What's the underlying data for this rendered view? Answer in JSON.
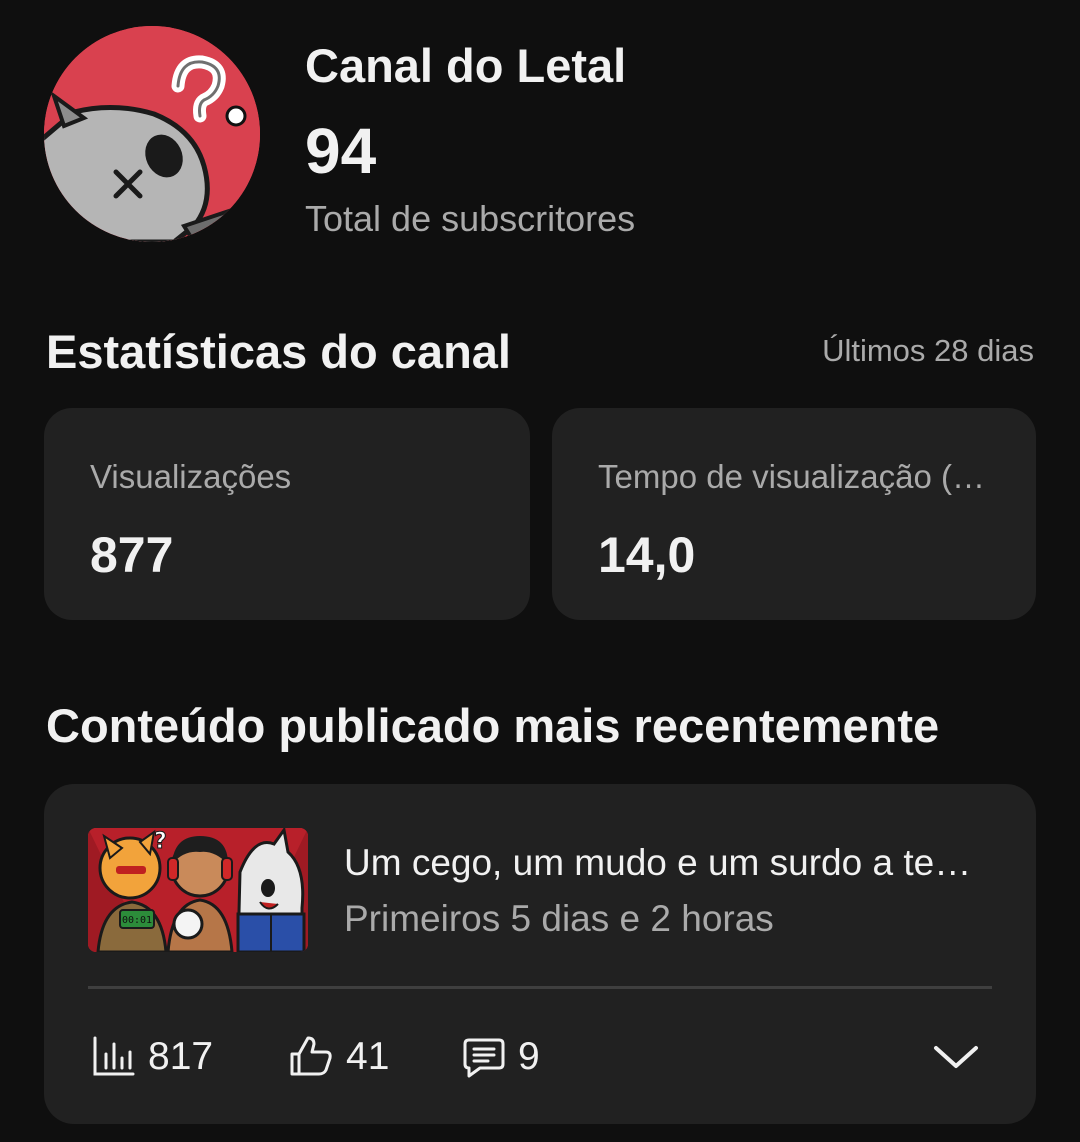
{
  "channel": {
    "name": "Canal do Letal",
    "subscriber_count": "94",
    "subscriber_label": "Total de subscritores"
  },
  "stats": {
    "title": "Estatísticas do canal",
    "period": "Últimos 28 dias",
    "cards": [
      {
        "label": "Visualizações",
        "value": "877"
      },
      {
        "label": "Tempo de visualização (…",
        "value": "14,0"
      }
    ]
  },
  "recent": {
    "title": "Conteúdo publicado mais recentemente",
    "video": {
      "title": "Um cego, um mudo e um surdo a te…",
      "subtitle": "Primeiros 5 dias e 2 horas",
      "thumbnail_text": "00:01",
      "metrics": {
        "views": "817",
        "likes": "41",
        "comments": "9"
      }
    }
  },
  "colors": {
    "background": "#0f0f0f",
    "card": "#212121",
    "text_primary": "#f1f1f1",
    "text_secondary": "#aaaaaa",
    "avatar_bg": "#d9414f"
  },
  "icons": {
    "views": "bar-chart-icon",
    "likes": "thumbs-up-icon",
    "comments": "comment-icon",
    "expand": "chevron-down-icon"
  }
}
